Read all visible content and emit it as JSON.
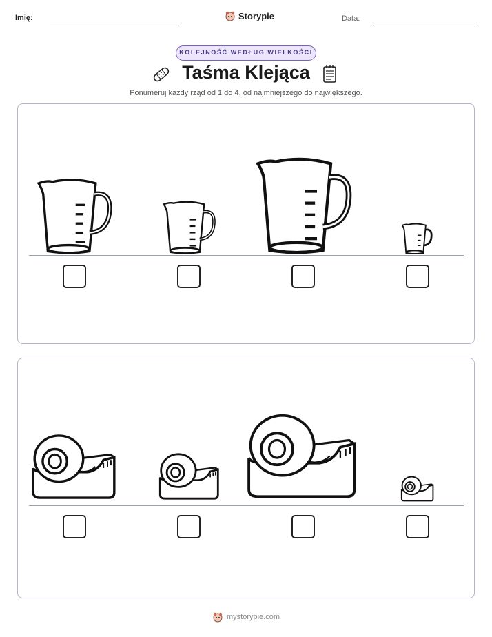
{
  "header": {
    "name_label": "Imię:",
    "date_label": "Data:",
    "brand": "Storypie"
  },
  "badge": "KOLEJNOŚĆ WEDŁUG WIELKOŚCI",
  "title": "Taśma Klejąca",
  "instruction": "Ponumeruj każdy rząd od 1 do 4, od najmniejszego do największego.",
  "rows": [
    {
      "object": "measuring-cup",
      "relative_sizes": [
        0.72,
        0.52,
        1.0,
        0.3
      ],
      "answers": [
        "",
        "",
        "",
        ""
      ]
    },
    {
      "object": "tape-dispenser",
      "relative_sizes": [
        0.78,
        0.55,
        1.0,
        0.3
      ],
      "answers": [
        "",
        "",
        "",
        ""
      ]
    }
  ],
  "footer": "mystorypie.com",
  "colors": {
    "badge_border": "#7a5fc0",
    "badge_fill": "#ece6fa",
    "panel_border": "#b5b5c8",
    "baseline": "#9aa3b3"
  },
  "icons": [
    "bandage-icon",
    "notepad-icon",
    "storypie-logo-icon"
  ]
}
